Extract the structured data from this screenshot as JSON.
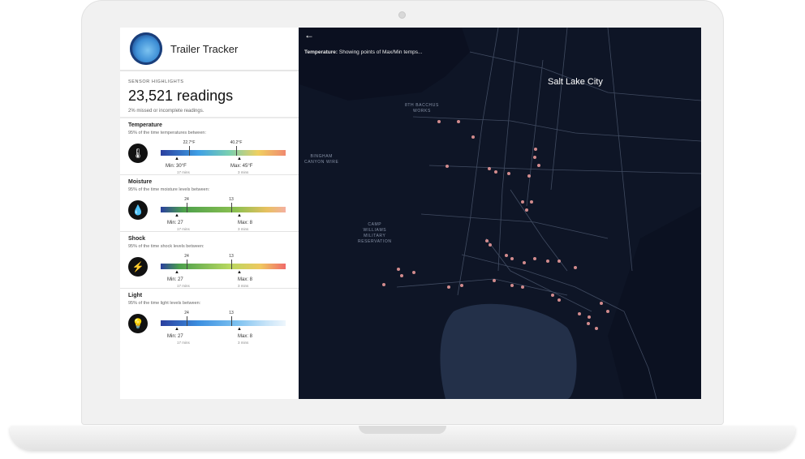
{
  "app": {
    "title": "Trailer Tracker"
  },
  "highlights": {
    "label": "SENSOR HIGHLIGHTS",
    "count": "23,521 readings",
    "note": "2% missed or incomplete readings."
  },
  "sensors": [
    {
      "title": "Temperature",
      "desc": "95% of the time temperatures between:",
      "left_tick": "22.7°F",
      "right_tick": "40.2°F",
      "min": "Min: 30°F",
      "min_dur": "17 mins",
      "max": "Max: 45°F",
      "max_dur": "3 mins",
      "icon": "thermometer-icon"
    },
    {
      "title": "Moisture",
      "desc": "95% of the time moisture levels between:",
      "left_tick": "24",
      "right_tick": "13",
      "min": "Min: 27",
      "min_dur": "17 mins",
      "max": "Max: 8",
      "max_dur": "3 mins",
      "icon": "droplet-icon"
    },
    {
      "title": "Shock",
      "desc": "95% of the time shock levels between:",
      "left_tick": "24",
      "right_tick": "13",
      "min": "Min: 27",
      "min_dur": "17 mins",
      "max": "Max: 8",
      "max_dur": "3 mins",
      "icon": "lightning-icon"
    },
    {
      "title": "Light",
      "desc": "95% of the time light levels between:",
      "left_tick": "24",
      "right_tick": "13",
      "min": "Min: 27",
      "min_dur": "17 mins",
      "max": "Max: 8",
      "max_dur": "3 mins",
      "icon": "lightbulb-icon"
    }
  ],
  "map": {
    "caption_bold": "Temperature:",
    "caption_text": " Showing points of Max/Min temps...",
    "city": "Salt Lake City",
    "labels": {
      "works_1": "8TH BACCHUS",
      "works_2": "WORKS",
      "bingham_1": "BINGHAM",
      "bingham_2": "CANYON WIRE",
      "camp_1": "CAMP",
      "camp_2": "WILLIAMS",
      "camp_3": "MILITARY",
      "camp_4": "RESERVATION"
    },
    "point_color": "#f4a0a0"
  }
}
